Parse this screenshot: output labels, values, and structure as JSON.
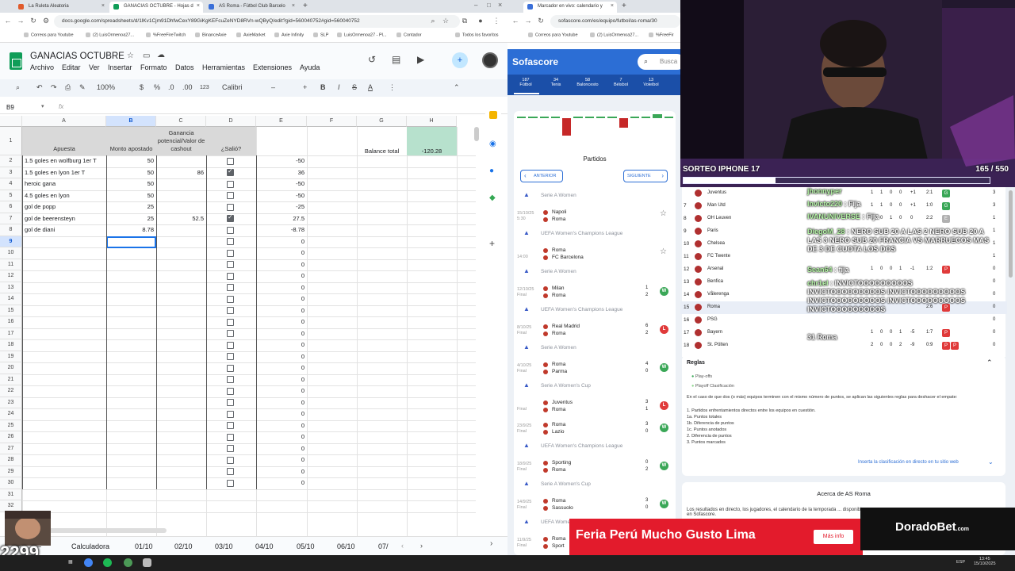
{
  "browser1": {
    "tabs": [
      {
        "title": "La Ruleta Aleatoria",
        "color": "#e05a2b"
      },
      {
        "title": "GANACIAS OCTUBRE - Hojas d",
        "color": "#0f9d58"
      },
      {
        "title": "AS Roma - Fútbol Club Barcelo",
        "color": "#3a6fd8"
      }
    ],
    "url": "docs.google.com/spreadsheets/d/1lKv1Cjm91DhfwCexY89GiKgKEFcuZeNYD8RVn-wQByQ/edit?gid=560040752#gid=560040752",
    "bookmarks": [
      "Correos para Youtube",
      "(2) LuisOrmenoa27...",
      "%FreeFireTwitch",
      "BinanceAxie",
      "AxieMarket",
      "Axie Infinity",
      "SLP",
      "LuisOrmenoa27 - Pl...",
      "Contador",
      "Todos los favoritos"
    ]
  },
  "sheets": {
    "title": "GANACIAS OCTUBRE",
    "menu": [
      "Archivo",
      "Editar",
      "Ver",
      "Insertar",
      "Formato",
      "Datos",
      "Herramientas",
      "Extensiones",
      "Ayuda"
    ],
    "toolbar": {
      "zoom": "100%",
      "currency": "$",
      "percent": "%",
      "decimals_less": ".0",
      "decimals_more": ".00",
      "numfmt": "123",
      "font": "Calibri",
      "size": "11",
      "bold": "B",
      "italic": "I",
      "strike": "S",
      "textcolor": "A"
    },
    "namebox": "B9",
    "fx": "fx",
    "columns": [
      "A",
      "B",
      "C",
      "D",
      "E",
      "F",
      "G",
      "H"
    ],
    "headers": {
      "a": "Apuesta",
      "b": "Monto apostado",
      "c": "Ganancia potencial/Valor de cashout",
      "d": "¿Salió?",
      "g": "Balance total",
      "h": "-120.28"
    },
    "rows": [
      {
        "n": "2",
        "a": "1.5 goles en wolfburg 1er T",
        "b": "50",
        "c": "",
        "d": false,
        "e": "-50"
      },
      {
        "n": "3",
        "a": "1.5 goles en lyon 1er T",
        "b": "50",
        "c": "86",
        "d": true,
        "e": "36"
      },
      {
        "n": "4",
        "a": "heroic gana",
        "b": "50",
        "c": "",
        "d": false,
        "e": "-50"
      },
      {
        "n": "5",
        "a": "4.5 goles en lyon",
        "b": "50",
        "c": "",
        "d": false,
        "e": "-50"
      },
      {
        "n": "6",
        "a": "gol de popp",
        "b": "25",
        "c": "",
        "d": false,
        "e": "-25"
      },
      {
        "n": "7",
        "a": "gol de beerensteyn",
        "b": "25",
        "c": "52.5",
        "d": true,
        "e": "27.5"
      },
      {
        "n": "8",
        "a": "gol de diani",
        "b": "8.78",
        "c": "",
        "d": false,
        "e": "-8.78"
      },
      {
        "n": "9",
        "a": "",
        "b": "",
        "c": "",
        "d": false,
        "e": "0"
      },
      {
        "n": "10",
        "a": "",
        "b": "",
        "c": "",
        "d": false,
        "e": "0"
      },
      {
        "n": "11",
        "a": "",
        "b": "",
        "c": "",
        "d": false,
        "e": "0"
      },
      {
        "n": "12",
        "a": "",
        "b": "",
        "c": "",
        "d": false,
        "e": "0"
      },
      {
        "n": "13",
        "a": "",
        "b": "",
        "c": "",
        "d": false,
        "e": "0"
      },
      {
        "n": "14",
        "a": "",
        "b": "",
        "c": "",
        "d": false,
        "e": "0"
      },
      {
        "n": "15",
        "a": "",
        "b": "",
        "c": "",
        "d": false,
        "e": "0"
      },
      {
        "n": "16",
        "a": "",
        "b": "",
        "c": "",
        "d": false,
        "e": "0"
      },
      {
        "n": "17",
        "a": "",
        "b": "",
        "c": "",
        "d": false,
        "e": "0"
      },
      {
        "n": "18",
        "a": "",
        "b": "",
        "c": "",
        "d": false,
        "e": "0"
      },
      {
        "n": "19",
        "a": "",
        "b": "",
        "c": "",
        "d": false,
        "e": "0"
      },
      {
        "n": "20",
        "a": "",
        "b": "",
        "c": "",
        "d": false,
        "e": "0"
      },
      {
        "n": "21",
        "a": "",
        "b": "",
        "c": "",
        "d": false,
        "e": "0"
      },
      {
        "n": "22",
        "a": "",
        "b": "",
        "c": "",
        "d": false,
        "e": "0"
      },
      {
        "n": "23",
        "a": "",
        "b": "",
        "c": "",
        "d": false,
        "e": "0"
      },
      {
        "n": "24",
        "a": "",
        "b": "",
        "c": "",
        "d": false,
        "e": "0"
      },
      {
        "n": "25",
        "a": "",
        "b": "",
        "c": "",
        "d": false,
        "e": "0"
      },
      {
        "n": "26",
        "a": "",
        "b": "",
        "c": "",
        "d": false,
        "e": "0"
      },
      {
        "n": "27",
        "a": "",
        "b": "",
        "c": "",
        "d": false,
        "e": "0"
      },
      {
        "n": "28",
        "a": "",
        "b": "",
        "c": "",
        "d": false,
        "e": "0"
      },
      {
        "n": "29",
        "a": "",
        "b": "",
        "c": "",
        "d": false,
        "e": "0"
      },
      {
        "n": "30",
        "a": "",
        "b": "",
        "c": "",
        "d": false,
        "e": "0"
      },
      {
        "n": "31",
        "a": "",
        "b": "",
        "c": "",
        "d": null,
        "e": ""
      },
      {
        "n": "32",
        "a": "",
        "b": "",
        "c": "",
        "d": null,
        "e": ""
      }
    ],
    "sheettabs": [
      "Calculadora",
      "01/10",
      "02/10",
      "03/10",
      "04/10",
      "05/10",
      "06/10",
      "07/"
    ]
  },
  "browser2": {
    "tabs": [
      {
        "title": "Marcador en vivo: calendario y",
        "color": "#3a6fd8"
      }
    ],
    "url": "sofascore.com/es/equipo/futbol/as-roma/30",
    "bookmarks": [
      "Correos para Youtube",
      "(2) LuisOrmenoa27...",
      "%FreeFir"
    ],
    "brand": "Sofascore",
    "search": "Busca",
    "sports": [
      {
        "label": "Fútbol",
        "count": "187"
      },
      {
        "label": "Tenis",
        "count": "34"
      },
      {
        "label": "Baloncesto",
        "count": "58"
      },
      {
        "label": "Béisbol",
        "count": "7"
      },
      {
        "label": "Voleibol",
        "count": "13"
      }
    ],
    "section": "Partidos",
    "prev": "ANTERIOR",
    "next": "SIGUIENTE",
    "matches": [
      {
        "league": "Serie A Women",
        "date": "15/10/25",
        "time": "5:30",
        "home": "Napoli",
        "away": "Roma",
        "score_h": "",
        "score_a": "",
        "result": "star"
      },
      {
        "league": "UEFA Women's Champions League",
        "date": "",
        "time": "14:00",
        "home": "Roma",
        "away": "FC Barcelona",
        "score_h": "",
        "score_a": "",
        "result": "star"
      },
      {
        "league": "Serie A Women",
        "date": "12/10/25",
        "time": "Final",
        "home": "Milan",
        "away": "Roma",
        "score_h": "1",
        "score_a": "2",
        "result": "W"
      },
      {
        "league": "UEFA Women's Champions League",
        "date": "8/10/25",
        "time": "Final",
        "home": "Real Madrid",
        "away": "Roma",
        "score_h": "6",
        "score_a": "2",
        "result": "L"
      },
      {
        "league": "Serie A Women",
        "date": "4/10/25",
        "time": "Final",
        "home": "Roma",
        "away": "Parma",
        "score_h": "4",
        "score_a": "0",
        "result": "W"
      },
      {
        "league": "Serie A Women's Cup",
        "date": "",
        "time": "Final",
        "home": "Juventus",
        "away": "Roma",
        "score_h": "3",
        "score_a": "1",
        "result": "L"
      },
      {
        "league": "",
        "date": "23/9/25",
        "time": "Final",
        "home": "Roma",
        "away": "Lazio",
        "score_h": "3",
        "score_a": "0",
        "result": "W"
      },
      {
        "league": "UEFA Women's Champions League",
        "date": "18/9/25",
        "time": "Final",
        "home": "Sporting",
        "away": "Roma",
        "score_h": "0",
        "score_a": "2",
        "result": "W"
      },
      {
        "league": "Serie A Women's Cup",
        "date": "14/9/25",
        "time": "Final",
        "home": "Roma",
        "away": "Sassuolo",
        "score_h": "3",
        "score_a": "0",
        "result": "W"
      },
      {
        "league": "UEFA Women's Champions",
        "date": "11/9/25",
        "time": "Final",
        "home": "Roma",
        "away": "Sport",
        "score_h": "",
        "score_a": "",
        "result": ""
      }
    ]
  },
  "stream": {
    "giveaway_label": "SORTEO IPHONE 17",
    "giveaway_count": "165 / 550",
    "giveaway_progress": 0.3,
    "standings": [
      {
        "pos": "",
        "team": "Juventus",
        "vals": [
          "1",
          "1",
          "0",
          "0",
          "+1",
          "2:1"
        ],
        "form": "G",
        "pts": "3"
      },
      {
        "pos": "7",
        "team": "Man Utd",
        "vals": [
          "1",
          "1",
          "0",
          "0",
          "+1",
          "1:0"
        ],
        "form": "G",
        "pts": "3"
      },
      {
        "pos": "8",
        "team": "OH Leuven",
        "vals": [
          "1",
          "0",
          "1",
          "0",
          "0",
          "2:2"
        ],
        "form": "E",
        "pts": "1"
      },
      {
        "pos": "9",
        "team": "Paris",
        "vals": [
          "",
          "",
          "",
          "",
          "",
          ""
        ],
        "form": "",
        "pts": "1"
      },
      {
        "pos": "10",
        "team": "Chelsea",
        "vals": [
          "",
          "",
          "",
          "",
          "",
          ""
        ],
        "form": "",
        "pts": "1"
      },
      {
        "pos": "11",
        "team": "FC Twente",
        "vals": [
          "",
          "",
          "",
          "",
          "",
          ""
        ],
        "form": "",
        "pts": "1"
      },
      {
        "pos": "12",
        "team": "Arsenal",
        "vals": [
          "1",
          "0",
          "0",
          "1",
          "-1",
          "1:2"
        ],
        "form": "P",
        "pts": "0"
      },
      {
        "pos": "13",
        "team": "Benfica",
        "vals": [
          "",
          "",
          "",
          "",
          "",
          ""
        ],
        "form": "",
        "pts": "0"
      },
      {
        "pos": "14",
        "team": "Vålerenga",
        "vals": [
          "",
          "",
          "",
          "",
          "",
          ""
        ],
        "form": "",
        "pts": "0"
      },
      {
        "pos": "15",
        "team": "Roma",
        "vals": [
          "",
          "",
          "",
          "",
          "",
          "2:6"
        ],
        "form": "P",
        "pts": "0"
      },
      {
        "pos": "16",
        "team": "PSG",
        "vals": [
          "",
          "",
          "",
          "",
          "",
          ""
        ],
        "form": "",
        "pts": "0"
      },
      {
        "pos": "17",
        "team": "Bayern",
        "vals": [
          "1",
          "0",
          "0",
          "1",
          "-5",
          "1:7"
        ],
        "form": "P",
        "pts": "0"
      },
      {
        "pos": "18",
        "team": "St. Pölten",
        "vals": [
          "2",
          "0",
          "0",
          "2",
          "-9",
          "0:9"
        ],
        "form": "P P",
        "pts": "0"
      }
    ],
    "chat": [
      {
        "user": "jhonnyper",
        "msg": ""
      },
      {
        "user": "Invicto220",
        "msg": "Fija"
      },
      {
        "user": "IVANUNIVERSE",
        "msg": "Fija"
      },
      {
        "user": "DiegoM_28",
        "msg": "NERO SUB 20 A LAS 2 NERO SUB 20 A LAS 3 NERO SUB 20 FRANCIA VS MARRUECOS MAS DE 3 DE CUOTA LOS DOS"
      },
      {
        "user": "Sean64",
        "msg": "fija"
      },
      {
        "user": "chr1el",
        "msg": "INVICTOOOOOOOOOS INVICTOOOOOOOOOS INVICTOOOOOOOOOS INVICTOOOOOOOOOS INVICTOOOOOOOOOS INVICTOOOOOOOOOS"
      },
      {
        "user": "",
        "msg": "31 Roma"
      }
    ],
    "rules": {
      "title": "Reglas",
      "legend": [
        "Play-offs",
        "Playoff Clasificación"
      ],
      "text": "En el caso de que dos (o más) equipos terminen con el mismo número de puntos, se aplican las siguientes reglas para deshacer el empate:",
      "list": [
        "1. Partidos enfrentamientos directos entre los equipos en cuestión.",
        "1a. Puntos totales",
        "1b. Diferencia de puntos",
        "1c. Puntos anotados",
        "2. Diferencia de puntos",
        "3. Puntos marcados"
      ],
      "embed": "Inserta la clasificación en directo en tu sitio web"
    },
    "about_title": "Acerca de AS Roma",
    "about_text": "Los resultados en directo, los jugadores, el calendario de la temporada ... disponibles en Sofascore.",
    "ad_text": "Feria Perú Mucho Gusto Lima",
    "ad_button": "Más info",
    "ad_brand": "DoradoBet",
    "ad_brand_suffix": ".com",
    "webcam_counter": "2299"
  },
  "taskbar": {
    "time": "13:45",
    "date": "15/10/2025",
    "lang": "ESP"
  },
  "colors": {
    "sheet_green": "#0f9d58",
    "sofa_blue": "#2c6ed5",
    "win": "#3aa757",
    "loss": "#e03a3a"
  }
}
